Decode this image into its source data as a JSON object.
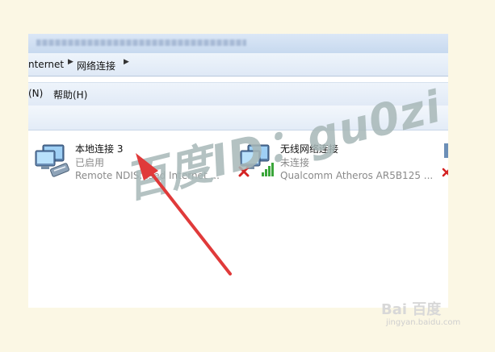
{
  "window": {
    "blurred_title": ""
  },
  "address_bar": {
    "crumbs": [
      "nternet",
      "网络连接"
    ]
  },
  "menu": {
    "items": [
      "(N)",
      "帮助(H)"
    ]
  },
  "connections": [
    {
      "name": "本地连接 3",
      "status": "已启用",
      "device": "Remote NDIS...sed Internet ...",
      "icon": "wired-network-adapter-icon",
      "has_error": false
    },
    {
      "name": "无线网络连接",
      "status": "未连接",
      "device": "Qualcomm Atheros AR5B125 ...",
      "icon": "wireless-network-adapter-icon",
      "has_error": true
    }
  ],
  "watermark": {
    "text": "百度ID：gu0zi"
  },
  "branding": {
    "logo": "Bai 百度",
    "url": "jingyan.baidu.com"
  },
  "colors": {
    "arrow": "#e03a3a",
    "error_x": "#d42222",
    "signal": "#3aa63a"
  }
}
